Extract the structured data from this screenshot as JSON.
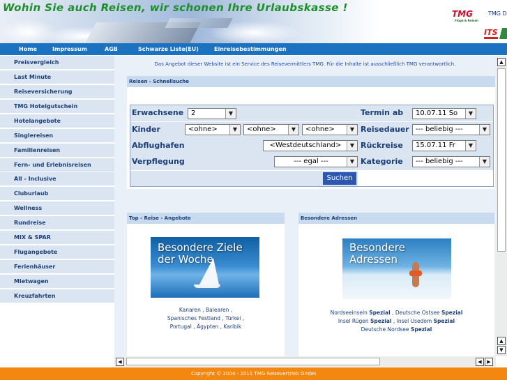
{
  "header": {
    "slogan": "Wohin Sie auch Reisen, wir schonen Ihre Urlaubskasse !",
    "logo_tmg": "TMG",
    "logo_tmg_tagline": "Flüge & Reisen",
    "logo_tmg_text": "TMG D",
    "logo_its": "ITS"
  },
  "nav": [
    "Home",
    "Impressum",
    "AGB",
    "Schwarze Liste(EU)",
    "Einreisebestimmungen"
  ],
  "sidebar": [
    "Preisvergleich",
    "Last Minute",
    "Reiseversicherung",
    "TMG Hotelgutschein",
    "Hotelangebote",
    "Singlereisen",
    "Familienreisen",
    "Fern- und Erlebnisreisen",
    "All - Inclusive",
    "Cluburlaub",
    "Wellness",
    "Rundreise",
    "MIX & SPAR",
    "Flugangebote",
    "Ferienhäuser",
    "Mietwagen",
    "Kreuzfahrten"
  ],
  "notice": "Das Angebot dieser Website ist ein Service des Reisevermittlers TMG. Für die Inhalte ist ausschließlich TMG verantwortlich.",
  "quicksearch": {
    "title": "Reisen - Schnellsuche",
    "labels": {
      "erwachsene": "Erwachsene",
      "kinder": "Kinder",
      "abflughafen": "Abflughafen",
      "verpflegung": "Verpflegung",
      "termin_ab": "Termin ab",
      "reisedauer": "Reisedauer",
      "rueckreise": "Rückreise",
      "kategorie": "Kategorie"
    },
    "values": {
      "erwachsene": "2",
      "kind1": "<ohne>",
      "kind2": "<ohne>",
      "kind3": "<ohne>",
      "abflughafen": "<Westdeutschland>",
      "verpflegung": "---   egal   ---",
      "termin_ab": "10.07.11 So",
      "reisedauer": "---  beliebig  ---",
      "rueckreise": "15.07.11 Fr",
      "kategorie": "---  beliebig  ---"
    },
    "search_button": "Suchen"
  },
  "top_offers": {
    "title": "Top - Reise - Angebote",
    "promo_caption": "Besondere Ziele der Woche",
    "links_line1": "Kanaren , Balearen ,",
    "links_line2": "Spanisches Festland , Türkei ,",
    "links_line3": "Portugal , Ägypten , Karibik"
  },
  "special_addresses": {
    "title": "Besondere Adressen",
    "promo_caption": "Besondere Adressen",
    "l1a": "Nordseeinseln ",
    "l1b": "Spezial",
    "l1c": " , Deutsche Ostsee ",
    "l1d": "Spezial",
    "l2a": "Insel Rügen ",
    "l2b": "Spezial",
    "l2c": " , Insel Usedom ",
    "l2d": "Spezial",
    "l3a": "Deutsche Nordsee ",
    "l3b": "Spezial"
  },
  "footer": "Copyright © 2004 - 2011 TMG Reisevertrieb GmbH",
  "colors": {
    "nav_bg": "#1a72c0",
    "sidebar_bg": "#dbe5f1",
    "link_text": "#1c3f78",
    "footer_bg": "#f4870f",
    "slogan": "#1d8f2a"
  },
  "icons": {
    "scroll_up": "triangle-up",
    "scroll_down": "triangle-down",
    "scroll_left": "triangle-left",
    "scroll_right": "triangle-right",
    "dropdown": "triangle-down"
  }
}
